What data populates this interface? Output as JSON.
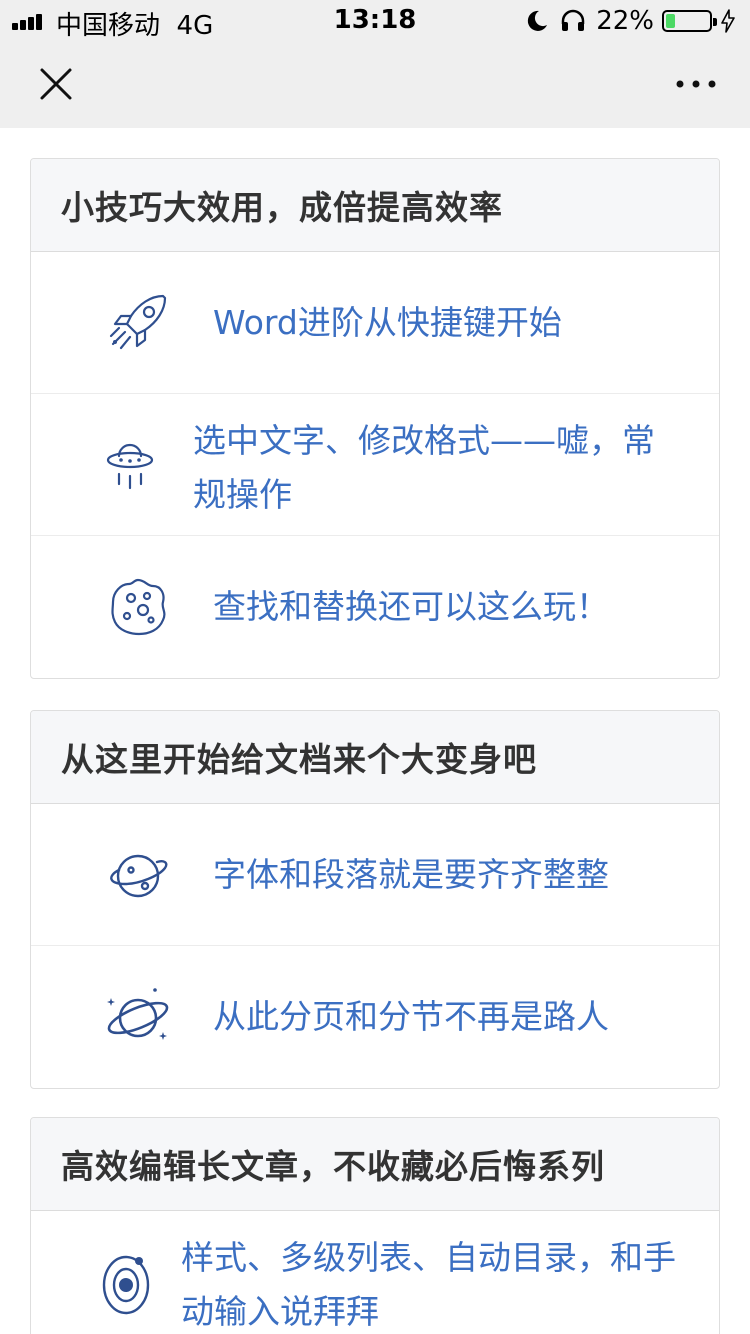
{
  "status_bar": {
    "carrier": "中国移动",
    "network": "4G",
    "time": "13:18",
    "battery_percent": "22%",
    "battery_level": 0.22,
    "icons": [
      "signal-icon",
      "moon-icon",
      "headphone-icon",
      "battery-icon",
      "charging-icon"
    ]
  },
  "nav_bar": {
    "close_icon": "close-icon",
    "more_icon": "more-icon"
  },
  "colors": {
    "accent": "#3b6fc2",
    "header_bg": "#f6f7f9",
    "chrome_bg": "#efefef",
    "title_text": "#333333"
  },
  "sections": [
    {
      "title": "小技巧大效用，成倍提高效率",
      "items": [
        {
          "icon": "rocket-icon",
          "label": "Word进阶从快捷键开始"
        },
        {
          "icon": "ufo-icon",
          "label": "选中文字、修改格式——嘘，常规操作"
        },
        {
          "icon": "moon-crater-icon",
          "label": "查找和替换还可以这么玩！"
        }
      ]
    },
    {
      "title": "从这里开始给文档来个大变身吧",
      "items": [
        {
          "icon": "planet-icon",
          "label": "字体和段落就是要齐齐整整"
        },
        {
          "icon": "saturn-icon",
          "label": "从此分页和分节不再是路人"
        }
      ]
    },
    {
      "title": "高效编辑长文章，不收藏必后悔系列",
      "items": [
        {
          "icon": "orbit-icon",
          "label": "样式、多级列表、自动目录，和手动输入说拜拜"
        }
      ]
    }
  ]
}
